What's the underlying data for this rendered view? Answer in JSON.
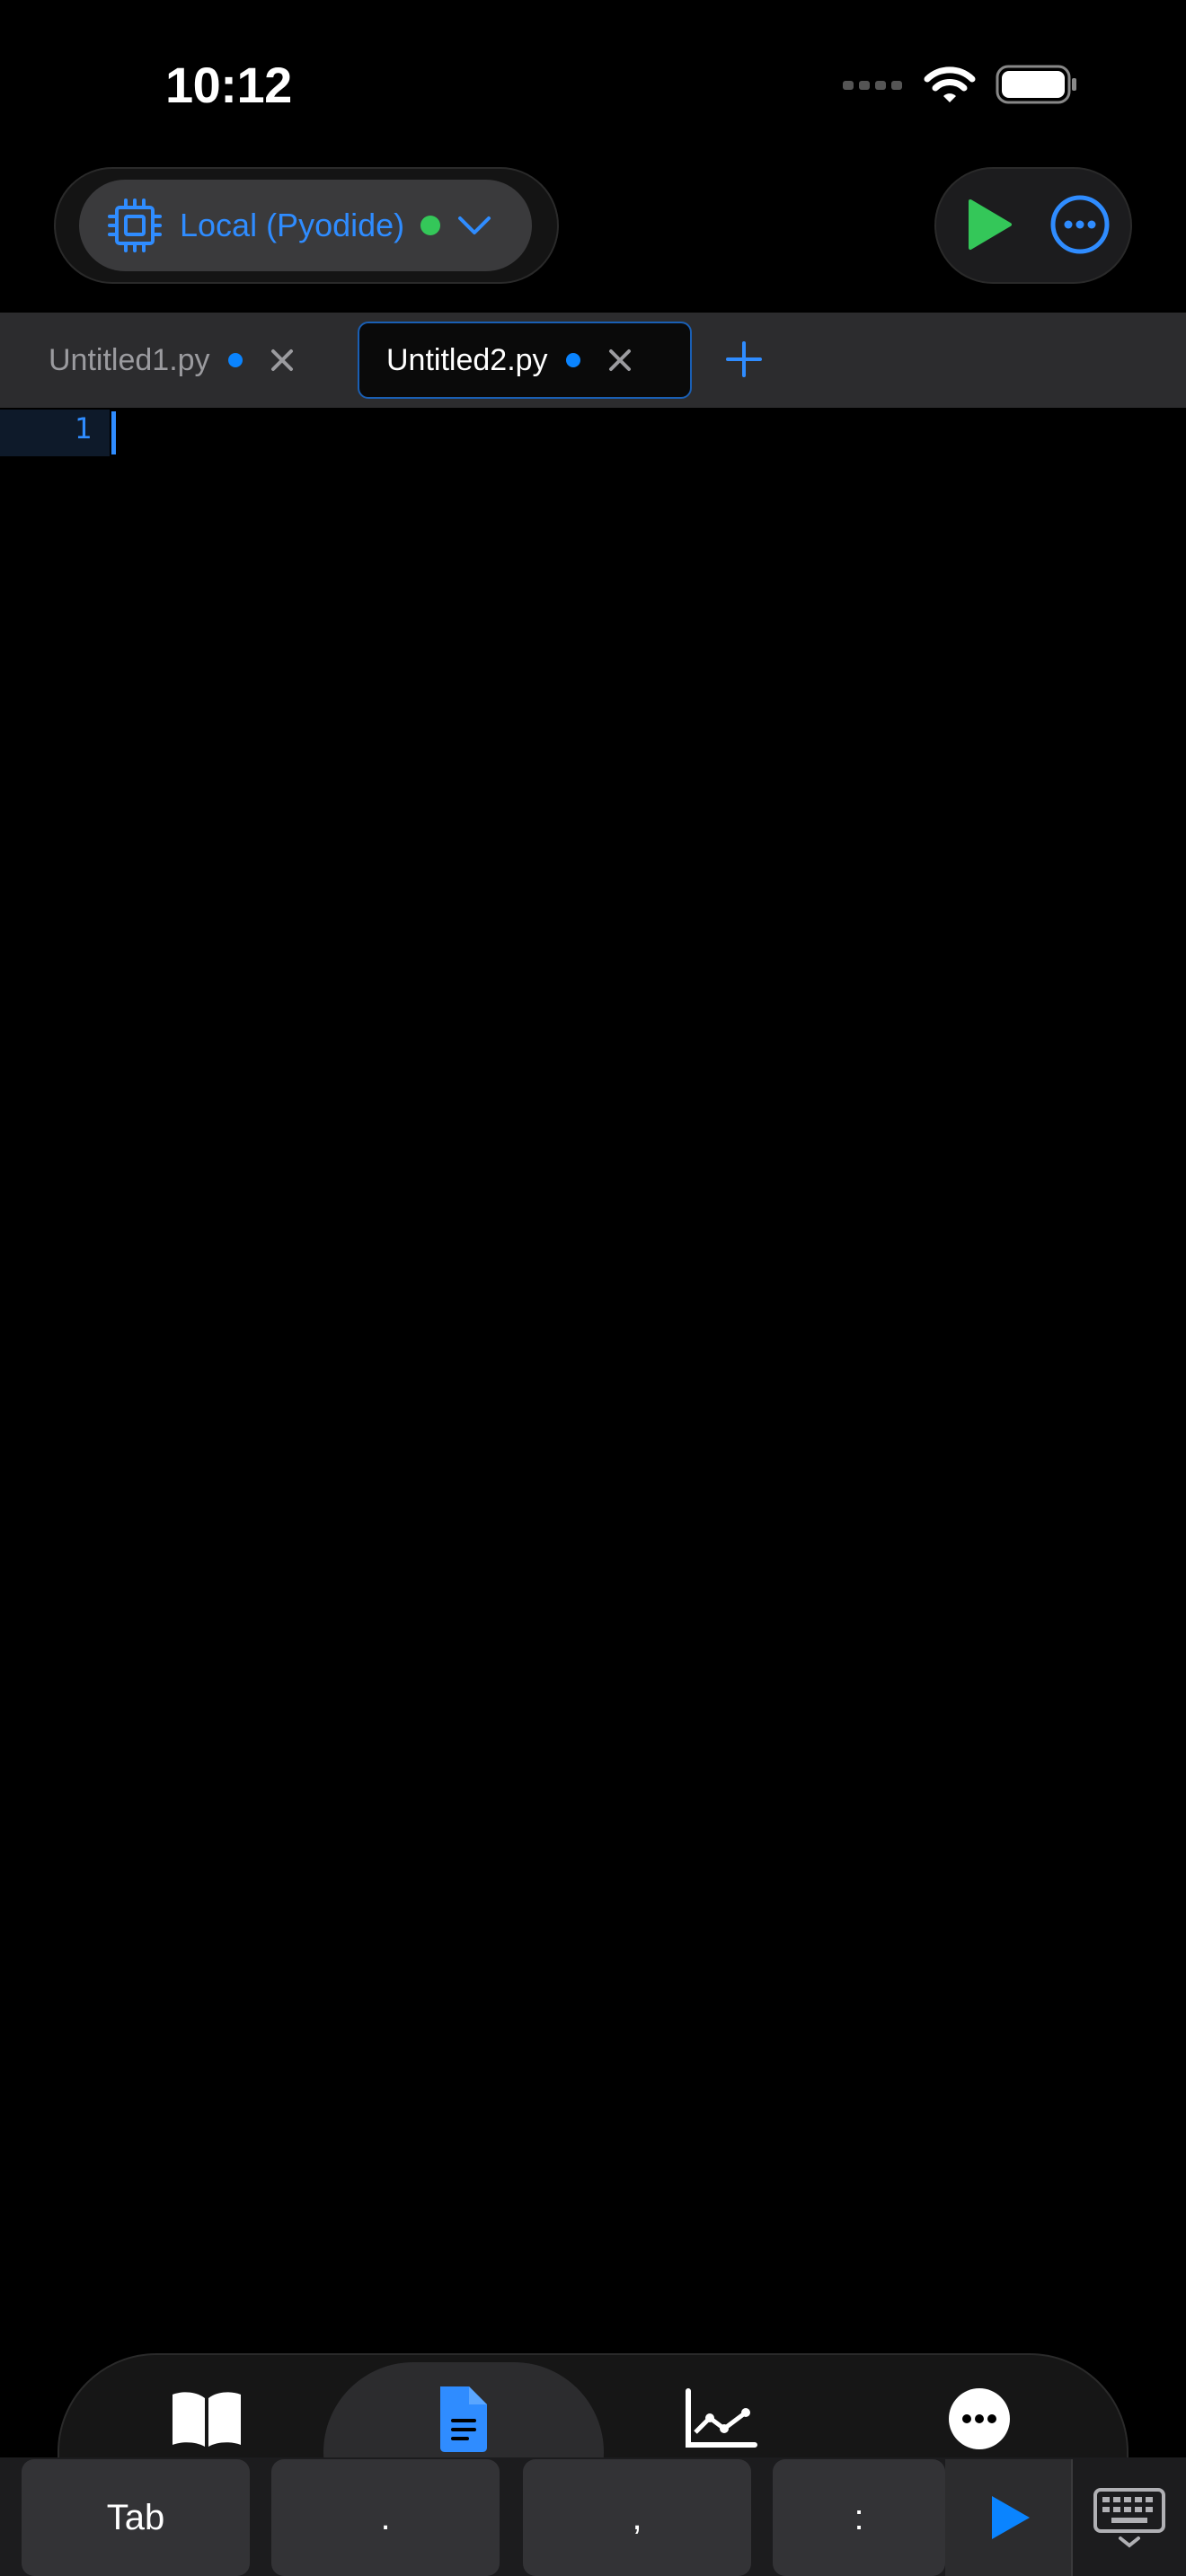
{
  "status_bar": {
    "time": "10:12",
    "icons": [
      "cellular-signal-icon",
      "wifi-icon",
      "battery-icon"
    ]
  },
  "toolbar": {
    "kernel_label": "Local (Pyodide)",
    "kernel_status": "connected",
    "kernel_icon": "cpu-chip-icon",
    "run_icon": "play-icon",
    "more_icon": "ellipsis-circle-icon"
  },
  "tabs": [
    {
      "label": "Untitled1.py",
      "active": false,
      "modified": true
    },
    {
      "label": "Untitled2.py",
      "active": true,
      "modified": true
    }
  ],
  "editor": {
    "line_numbers": [
      "1"
    ]
  },
  "bottom_nav": {
    "items": [
      {
        "icon": "book-icon",
        "active": false
      },
      {
        "icon": "document-icon",
        "active": true
      },
      {
        "icon": "line-chart-icon",
        "active": false
      },
      {
        "icon": "more-circle-icon",
        "active": false
      }
    ]
  },
  "accessory_keys": [
    "Tab",
    ".",
    ",",
    ":"
  ],
  "colors": {
    "accent": "#2f8cff",
    "run_green": "#34c759",
    "background": "#000000"
  }
}
